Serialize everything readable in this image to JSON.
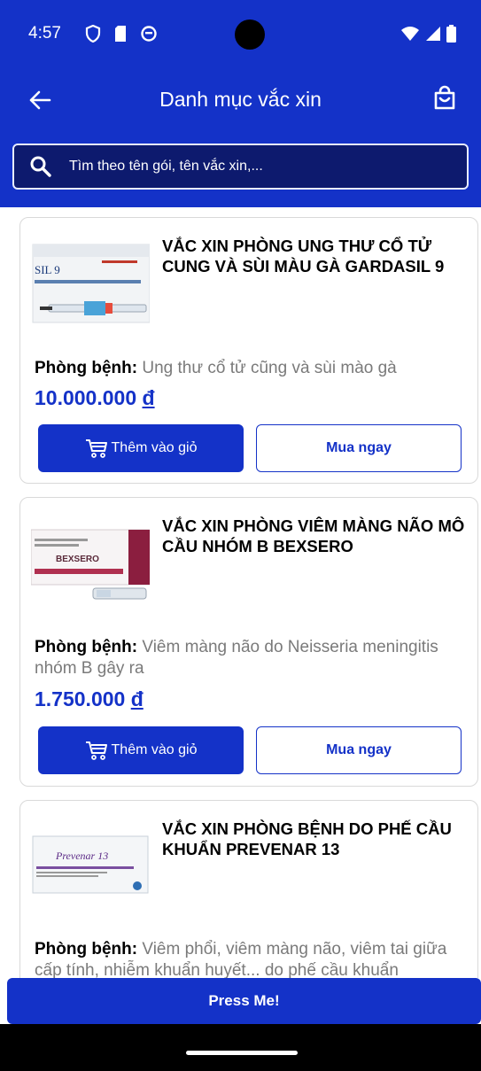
{
  "status_bar": {
    "time": "4:57"
  },
  "header": {
    "title": "Danh mục vắc xin"
  },
  "search": {
    "placeholder": "Tìm theo tên gói, tên vắc xin,..."
  },
  "products": [
    {
      "name": "VẮC XIN PHÒNG UNG THƯ CỔ TỬ CUNG VÀ SÙI MÀU GÀ GARDASIL 9",
      "disease_label": "Phòng bệnh:",
      "disease": "Ung thư cổ tử cũng và sùi mào gà",
      "price": "10.000.000",
      "currency": "đ",
      "add_to_cart": "Thêm vào giỏ",
      "buy_now": "Mua ngay",
      "image_text": "SIL 9"
    },
    {
      "name": "VẮC XIN PHÒNG VIÊM MÀNG NÃO MÔ CẦU NHÓM B BEXSERO",
      "disease_label": "Phòng bệnh:",
      "disease": "Viêm màng não do Neisseria meningitis nhóm B gây ra",
      "price": "1.750.000",
      "currency": "đ",
      "add_to_cart": "Thêm vào giỏ",
      "buy_now": "Mua ngay",
      "image_text": "BEXSERO"
    },
    {
      "name": "VẮC XIN PHÒNG BỆNH DO PHẾ CẦU KHUẨN PREVENAR 13",
      "disease_label": "Phòng bệnh:",
      "disease": "Viêm phổi, viêm màng não, viêm tai giữa cấp tính, nhiễm khuẩn huyết... do phế cầu khuẩn",
      "image_text": "Prevenar 13"
    }
  ],
  "footer_button": "Press Me!",
  "colors": {
    "primary": "#1432c8",
    "search_bg": "#0d1a6e",
    "muted_text": "#7a7a7a"
  }
}
